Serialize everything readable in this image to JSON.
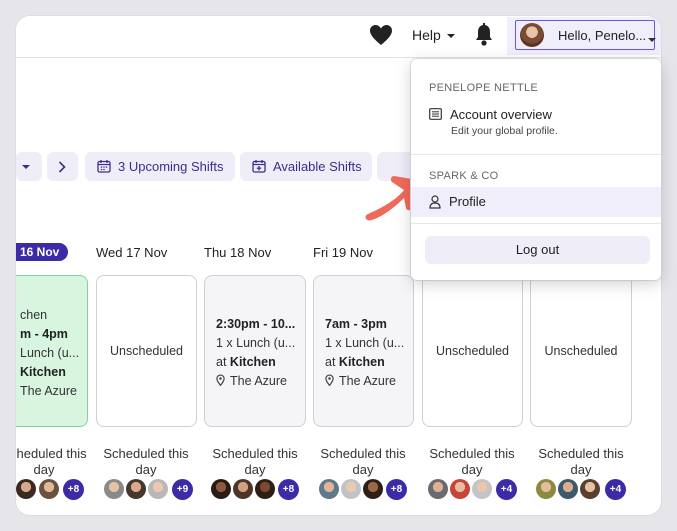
{
  "header": {
    "help_label": "Help",
    "user_label": "Hello, Penelo...",
    "icons": [
      "heart-icon",
      "bell-icon"
    ]
  },
  "toolbar": {
    "upcoming_label": "3 Upcoming Shifts",
    "available_label": "Available Shifts"
  },
  "days": [
    {
      "label": "16 Nov",
      "selected": true
    },
    {
      "label": "Wed 17 Nov"
    },
    {
      "label": "Thu 18 Nov"
    },
    {
      "label": "Fri 19 Nov"
    }
  ],
  "shifts": [
    {
      "lines": [
        "chen",
        "m - 4pm",
        "Lunch (u...",
        "Kitchen",
        "The Azure"
      ]
    },
    {
      "unscheduled": "Unscheduled"
    },
    {
      "time": "2:30pm - 10...",
      "role": "1 x Lunch (u...",
      "at": "at",
      "area": "Kitchen",
      "location": "The Azure"
    },
    {
      "time": "7am - 3pm",
      "role": "1 x Lunch (u...",
      "at": "at",
      "area": "Kitchen",
      "location": "The Azure"
    },
    {
      "unscheduled": "Unscheduled"
    },
    {
      "unscheduled": "Unscheduled"
    }
  ],
  "scheduled": {
    "text": "Scheduled this day",
    "counts": [
      "+8",
      "+9",
      "+8",
      "+8",
      "+4",
      "+4"
    ]
  },
  "dropdown": {
    "user_section": "PENELOPE NETTLE",
    "account_title": "Account overview",
    "account_sub": "Edit your global profile.",
    "org_section": "SPARK & CO",
    "profile_label": "Profile",
    "logout_label": "Log out"
  },
  "colors": {
    "accent": "#3b2ba6",
    "button_bg": "#efedf8",
    "green_card": "#d8f5e0",
    "annotation_arrow": "#f06a5a"
  }
}
